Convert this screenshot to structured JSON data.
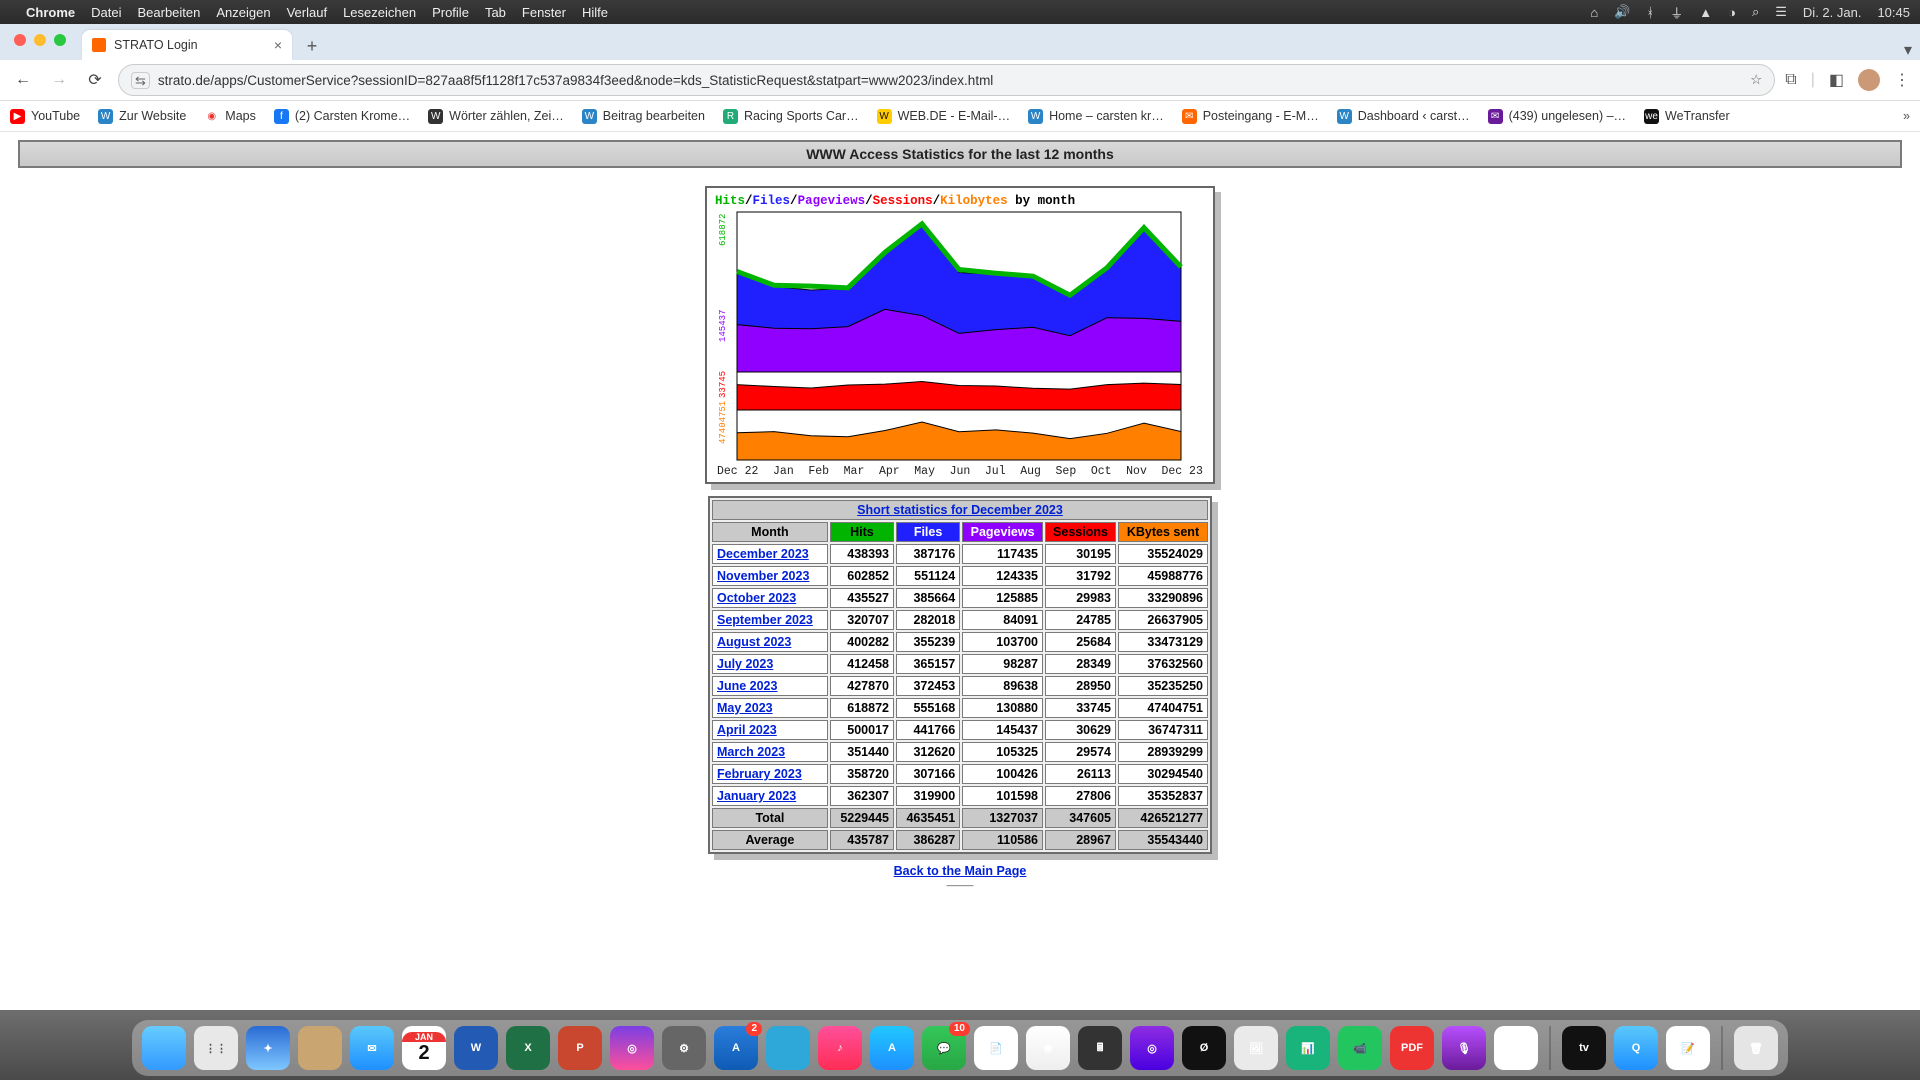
{
  "menubar": {
    "app": "Chrome",
    "items": [
      "Datei",
      "Bearbeiten",
      "Anzeigen",
      "Verlauf",
      "Lesezeichen",
      "Profile",
      "Tab",
      "Fenster",
      "Hilfe"
    ],
    "right": [
      "Di. 2. Jan.",
      "10:45"
    ]
  },
  "browser": {
    "tab_title": "STRATO Login",
    "url": "strato.de/apps/CustomerService?sessionID=827aa8f5f1128f17c537a9834f3eed&node=kds_StatisticRequest&statpart=www2023/index.html"
  },
  "bookmarks": [
    {
      "label": "YouTube",
      "color": "#ff0000"
    },
    {
      "label": "Zur Website",
      "color": "#2a84c6"
    },
    {
      "label": "Maps",
      "color": "#34a853"
    },
    {
      "label": "(2) Carsten Krome…",
      "color": "#1877f2"
    },
    {
      "label": "Wörter zählen, Zei…",
      "color": "#333"
    },
    {
      "label": "Beitrag bearbeiten",
      "color": "#2a84c6"
    },
    {
      "label": "Racing Sports Car…",
      "color": "#2a7"
    },
    {
      "label": "WEB.DE - E-Mail-…",
      "color": "#ffcc00"
    },
    {
      "label": "Home – carsten kr…",
      "color": "#2a84c6"
    },
    {
      "label": "Posteingang - E-M…",
      "color": "#f60"
    },
    {
      "label": "Dashboard ‹ carst…",
      "color": "#2a84c6"
    },
    {
      "label": "(439) ungelesen) –…",
      "color": "#6a1b9a"
    },
    {
      "label": "WeTransfer",
      "color": "#111"
    }
  ],
  "page": {
    "banner": "WWW Access Statistics for the last 12 months",
    "legend": {
      "a": "Hits",
      "b": "Files",
      "c": "Pageviews",
      "d": "Sessions",
      "e": "Kilobytes",
      "tail": " by month"
    },
    "xticks": [
      "Dec 22",
      "Jan",
      "Feb",
      "Mar",
      "Apr",
      "May",
      "Jun",
      "Jul",
      "Aug",
      "Sep",
      "Oct",
      "Nov",
      "Dec 23"
    ],
    "yticks": [
      "618872",
      "145437",
      "33745",
      "47404751"
    ],
    "table_title": "Short statistics for December 2023",
    "headers": {
      "month": "Month",
      "hits": "Hits",
      "files": "Files",
      "pv": "Pageviews",
      "sess": "Sessions",
      "kb": "KBytes sent"
    },
    "total_label": "Total",
    "average_label": "Average",
    "back": "Back to the Main Page"
  },
  "chart_data": {
    "type": "area",
    "title": "Hits/Files/Pageviews/Sessions/Kilobytes by month",
    "xlabel": "",
    "ylabel": "",
    "x": [
      "Dec 22",
      "Jan",
      "Feb",
      "Mar",
      "Apr",
      "May",
      "Jun",
      "Jul",
      "Aug",
      "Sep",
      "Oct",
      "Nov",
      "Dec 23"
    ],
    "series": [
      {
        "name": "Hits",
        "color": "#00b400",
        "values": [
          420000,
          362307,
          358720,
          351440,
          500017,
          618872,
          427870,
          412458,
          400282,
          320707,
          435527,
          602852,
          438393
        ]
      },
      {
        "name": "Files",
        "color": "#2020ff",
        "values": [
          370000,
          319900,
          307166,
          312620,
          441766,
          555168,
          372453,
          365157,
          355239,
          282018,
          385664,
          551124,
          387176
        ]
      },
      {
        "name": "Pageviews",
        "color": "#9000ff",
        "values": [
          110000,
          101598,
          100426,
          105325,
          145437,
          130880,
          89638,
          98287,
          103700,
          84091,
          125885,
          124335,
          117435
        ]
      },
      {
        "name": "Sessions",
        "color": "#ff0000",
        "values": [
          30000,
          27806,
          26113,
          29574,
          30629,
          33745,
          28950,
          28349,
          25684,
          24785,
          29983,
          31792,
          30195
        ]
      },
      {
        "name": "Kilobytes",
        "color": "#ff7f00",
        "values": [
          34000000,
          35352837,
          30294540,
          28939299,
          36747311,
          47404751,
          35235250,
          37632560,
          33473129,
          26637905,
          33290896,
          45988776,
          35524029
        ]
      }
    ]
  },
  "table": {
    "rows": [
      {
        "month": "December 2023",
        "hits": "438393",
        "files": "387176",
        "pv": "117435",
        "sess": "30195",
        "kb": "35524029"
      },
      {
        "month": "November 2023",
        "hits": "602852",
        "files": "551124",
        "pv": "124335",
        "sess": "31792",
        "kb": "45988776"
      },
      {
        "month": "October 2023",
        "hits": "435527",
        "files": "385664",
        "pv": "125885",
        "sess": "29983",
        "kb": "33290896"
      },
      {
        "month": "September 2023",
        "hits": "320707",
        "files": "282018",
        "pv": "84091",
        "sess": "24785",
        "kb": "26637905"
      },
      {
        "month": "August 2023",
        "hits": "400282",
        "files": "355239",
        "pv": "103700",
        "sess": "25684",
        "kb": "33473129"
      },
      {
        "month": "July 2023",
        "hits": "412458",
        "files": "365157",
        "pv": "98287",
        "sess": "28349",
        "kb": "37632560"
      },
      {
        "month": "June 2023",
        "hits": "427870",
        "files": "372453",
        "pv": "89638",
        "sess": "28950",
        "kb": "35235250"
      },
      {
        "month": "May 2023",
        "hits": "618872",
        "files": "555168",
        "pv": "130880",
        "sess": "33745",
        "kb": "47404751"
      },
      {
        "month": "April 2023",
        "hits": "500017",
        "files": "441766",
        "pv": "145437",
        "sess": "30629",
        "kb": "36747311"
      },
      {
        "month": "March 2023",
        "hits": "351440",
        "files": "312620",
        "pv": "105325",
        "sess": "29574",
        "kb": "28939299"
      },
      {
        "month": "February 2023",
        "hits": "358720",
        "files": "307166",
        "pv": "100426",
        "sess": "26113",
        "kb": "30294540"
      },
      {
        "month": "January 2023",
        "hits": "362307",
        "files": "319900",
        "pv": "101598",
        "sess": "27806",
        "kb": "35352837"
      }
    ],
    "total": {
      "hits": "5229445",
      "files": "4635451",
      "pv": "1327037",
      "sess": "347605",
      "kb": "426521277"
    },
    "average": {
      "hits": "435787",
      "files": "386287",
      "pv": "110586",
      "sess": "28967",
      "kb": "35543440"
    }
  },
  "dock_badges": {
    "calendar_top": "JAN",
    "calendar_day": "2",
    "messages": "2",
    "store": "10"
  }
}
